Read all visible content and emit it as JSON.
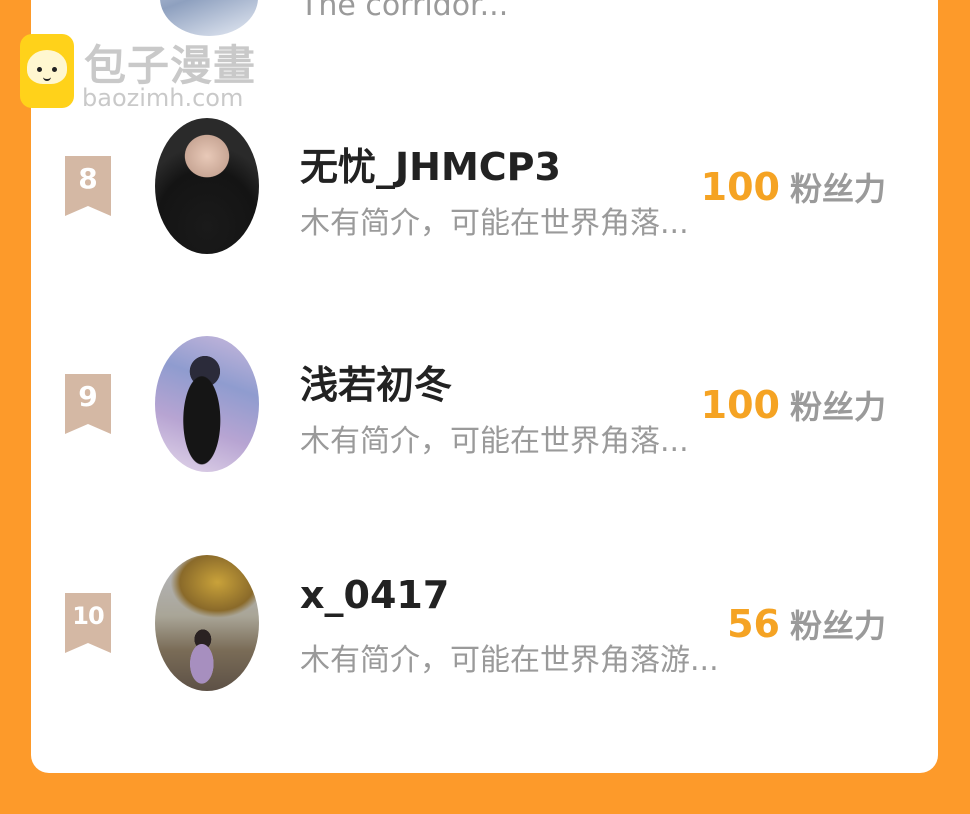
{
  "watermark": {
    "name": "包子漫畫",
    "url": "baozimh.com"
  },
  "previous_entry": {
    "intro": "The corridor..."
  },
  "fans_label": "粉丝力",
  "rankings": [
    {
      "rank": "8",
      "username": "无忧_JHMCP3",
      "intro": "木有简介，可能在世界角落...",
      "fans": "100"
    },
    {
      "rank": "9",
      "username": "浅若初冬",
      "intro": "木有简介，可能在世界角落...",
      "fans": "100"
    },
    {
      "rank": "10",
      "username": "x_0417",
      "intro": "木有简介，可能在世界角落游...",
      "fans": "56"
    }
  ],
  "colors": {
    "page_background": "#fd9a2a",
    "card_background": "#ffffff",
    "fans_number": "#f5a323",
    "rank_badge": "#d4b8a4",
    "username": "#222222",
    "secondary_text": "#9a9a9a"
  }
}
